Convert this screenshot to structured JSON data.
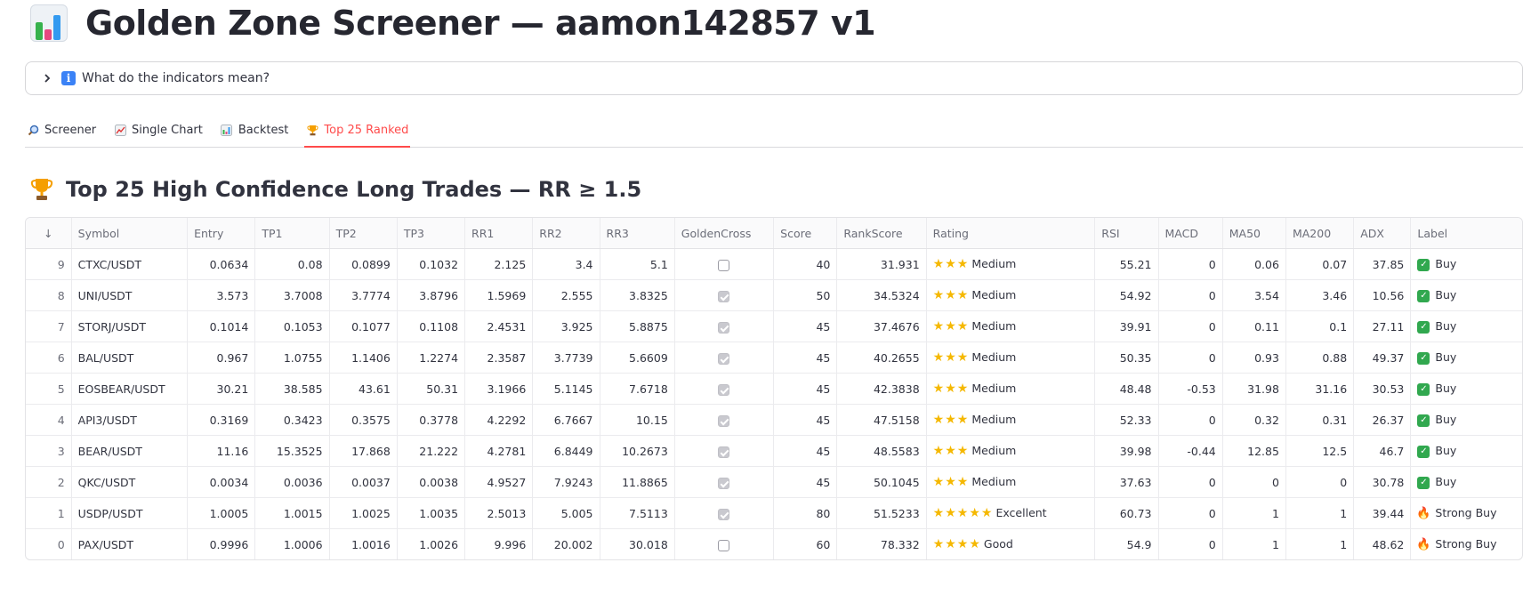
{
  "header": {
    "title": "Golden Zone Screener — aamon142857 v1",
    "icon": "bar-chart-icon"
  },
  "expander": {
    "label": "What do the indicators mean?",
    "icon": "info-icon"
  },
  "tabs": [
    {
      "label": "Screener",
      "icon": "magnifier-icon",
      "active": false
    },
    {
      "label": "Single Chart",
      "icon": "line-chart-icon",
      "active": false
    },
    {
      "label": "Backtest",
      "icon": "bar-chart-icon",
      "active": false
    },
    {
      "label": "Top 25 Ranked",
      "icon": "trophy-icon",
      "active": true
    }
  ],
  "section": {
    "title": "Top 25 High Confidence Long Trades — RR ≥ 1.5",
    "icon": "trophy-icon"
  },
  "colors": {
    "accent": "#ff4b4b",
    "buy": "#31a84f",
    "star": "#f5b800"
  },
  "table": {
    "sort_indicator": "↓",
    "columns": [
      "Symbol",
      "Entry",
      "TP1",
      "TP2",
      "TP3",
      "RR1",
      "RR2",
      "RR3",
      "GoldenCross",
      "Score",
      "RankScore",
      "Rating",
      "RSI",
      "MACD",
      "MA50",
      "MA200",
      "ADX",
      "Label"
    ],
    "rows": [
      {
        "idx": "9",
        "symbol": "CTXC/USDT",
        "entry": "0.0634",
        "tp1": "0.08",
        "tp2": "0.0899",
        "tp3": "0.1032",
        "rr1": "2.125",
        "rr2": "3.4",
        "rr3": "5.1",
        "golden_cross": false,
        "score": "40",
        "rank_score": "31.931",
        "stars": 3,
        "rating": "Medium",
        "rsi": "55.21",
        "macd": "0",
        "ma50": "0.06",
        "ma200": "0.07",
        "adx": "37.85",
        "label": "Buy",
        "label_icon": "check-icon"
      },
      {
        "idx": "8",
        "symbol": "UNI/USDT",
        "entry": "3.573",
        "tp1": "3.7008",
        "tp2": "3.7774",
        "tp3": "3.8796",
        "rr1": "1.5969",
        "rr2": "2.555",
        "rr3": "3.8325",
        "golden_cross": true,
        "score": "50",
        "rank_score": "34.5324",
        "stars": 3,
        "rating": "Medium",
        "rsi": "54.92",
        "macd": "0",
        "ma50": "3.54",
        "ma200": "3.46",
        "adx": "10.56",
        "label": "Buy",
        "label_icon": "check-icon"
      },
      {
        "idx": "7",
        "symbol": "STORJ/USDT",
        "entry": "0.1014",
        "tp1": "0.1053",
        "tp2": "0.1077",
        "tp3": "0.1108",
        "rr1": "2.4531",
        "rr2": "3.925",
        "rr3": "5.8875",
        "golden_cross": true,
        "score": "45",
        "rank_score": "37.4676",
        "stars": 3,
        "rating": "Medium",
        "rsi": "39.91",
        "macd": "0",
        "ma50": "0.11",
        "ma200": "0.1",
        "adx": "27.11",
        "label": "Buy",
        "label_icon": "check-icon"
      },
      {
        "idx": "6",
        "symbol": "BAL/USDT",
        "entry": "0.967",
        "tp1": "1.0755",
        "tp2": "1.1406",
        "tp3": "1.2274",
        "rr1": "2.3587",
        "rr2": "3.7739",
        "rr3": "5.6609",
        "golden_cross": true,
        "score": "45",
        "rank_score": "40.2655",
        "stars": 3,
        "rating": "Medium",
        "rsi": "50.35",
        "macd": "0",
        "ma50": "0.93",
        "ma200": "0.88",
        "adx": "49.37",
        "label": "Buy",
        "label_icon": "check-icon"
      },
      {
        "idx": "5",
        "symbol": "EOSBEAR/USDT",
        "entry": "30.21",
        "tp1": "38.585",
        "tp2": "43.61",
        "tp3": "50.31",
        "rr1": "3.1966",
        "rr2": "5.1145",
        "rr3": "7.6718",
        "golden_cross": true,
        "score": "45",
        "rank_score": "42.3838",
        "stars": 3,
        "rating": "Medium",
        "rsi": "48.48",
        "macd": "-0.53",
        "ma50": "31.98",
        "ma200": "31.16",
        "adx": "30.53",
        "label": "Buy",
        "label_icon": "check-icon"
      },
      {
        "idx": "4",
        "symbol": "API3/USDT",
        "entry": "0.3169",
        "tp1": "0.3423",
        "tp2": "0.3575",
        "tp3": "0.3778",
        "rr1": "4.2292",
        "rr2": "6.7667",
        "rr3": "10.15",
        "golden_cross": true,
        "score": "45",
        "rank_score": "47.5158",
        "stars": 3,
        "rating": "Medium",
        "rsi": "52.33",
        "macd": "0",
        "ma50": "0.32",
        "ma200": "0.31",
        "adx": "26.37",
        "label": "Buy",
        "label_icon": "check-icon"
      },
      {
        "idx": "3",
        "symbol": "BEAR/USDT",
        "entry": "11.16",
        "tp1": "15.3525",
        "tp2": "17.868",
        "tp3": "21.222",
        "rr1": "4.2781",
        "rr2": "6.8449",
        "rr3": "10.2673",
        "golden_cross": true,
        "score": "45",
        "rank_score": "48.5583",
        "stars": 3,
        "rating": "Medium",
        "rsi": "39.98",
        "macd": "-0.44",
        "ma50": "12.85",
        "ma200": "12.5",
        "adx": "46.7",
        "label": "Buy",
        "label_icon": "check-icon"
      },
      {
        "idx": "2",
        "symbol": "QKC/USDT",
        "entry": "0.0034",
        "tp1": "0.0036",
        "tp2": "0.0037",
        "tp3": "0.0038",
        "rr1": "4.9527",
        "rr2": "7.9243",
        "rr3": "11.8865",
        "golden_cross": true,
        "score": "45",
        "rank_score": "50.1045",
        "stars": 3,
        "rating": "Medium",
        "rsi": "37.63",
        "macd": "0",
        "ma50": "0",
        "ma200": "0",
        "adx": "30.78",
        "label": "Buy",
        "label_icon": "check-icon"
      },
      {
        "idx": "1",
        "symbol": "USDP/USDT",
        "entry": "1.0005",
        "tp1": "1.0015",
        "tp2": "1.0025",
        "tp3": "1.0035",
        "rr1": "2.5013",
        "rr2": "5.005",
        "rr3": "7.5113",
        "golden_cross": true,
        "score": "80",
        "rank_score": "51.5233",
        "stars": 5,
        "rating": "Excellent",
        "rsi": "60.73",
        "macd": "0",
        "ma50": "1",
        "ma200": "1",
        "adx": "39.44",
        "label": "Strong Buy",
        "label_icon": "fire-icon"
      },
      {
        "idx": "0",
        "symbol": "PAX/USDT",
        "entry": "0.9996",
        "tp1": "1.0006",
        "tp2": "1.0016",
        "tp3": "1.0026",
        "rr1": "9.996",
        "rr2": "20.002",
        "rr3": "30.018",
        "golden_cross": false,
        "score": "60",
        "rank_score": "78.332",
        "stars": 4,
        "rating": "Good",
        "rsi": "54.9",
        "macd": "0",
        "ma50": "1",
        "ma200": "1",
        "adx": "48.62",
        "label": "Strong Buy",
        "label_icon": "fire-icon"
      }
    ]
  }
}
